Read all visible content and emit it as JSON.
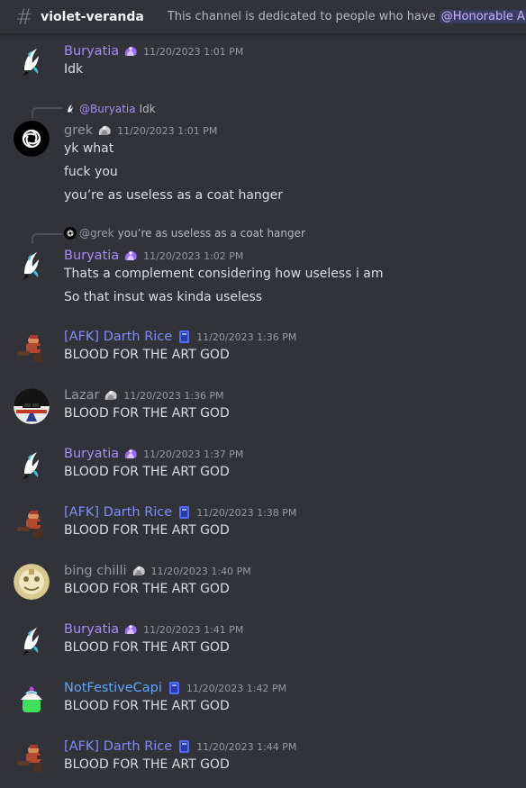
{
  "header": {
    "channel": "violet-veranda",
    "topic_text": "This channel is dedicated to people who have",
    "topic_mention": "@Honorable Artist"
  },
  "colors": {
    "background": "#313338",
    "buryatia": "#a78bfa",
    "afk": "#818cf8",
    "grey_user": "#949ba4",
    "notfestive": "#60a5fa"
  },
  "messages": [
    {
      "author": "Buryatia",
      "avatar": "buryatia-avatar",
      "badge": "purple-badge-icon",
      "time": "11/20/2023 1:01 PM",
      "lines": [
        "Idk"
      ]
    },
    {
      "reply_to": "@Buryatia",
      "reply_text": "Idk",
      "author": "grek",
      "avatar": "grek-avatar",
      "badge": "grey-badge-icon",
      "time": "11/20/2023 1:01 PM",
      "lines": [
        "yk what",
        "fuck you",
        "you’re as useless as a coat hanger"
      ]
    },
    {
      "reply_to": "@grek",
      "reply_text": "you’re as useless as a coat hanger",
      "author": "Buryatia",
      "avatar": "buryatia-avatar",
      "badge": "purple-badge-icon",
      "time": "11/20/2023 1:02 PM",
      "lines": [
        "Thats a complement considering how useless i am",
        "So that insut was kinda useless"
      ]
    },
    {
      "author": "[AFK] Darth Rice",
      "avatar": "darth-rice-avatar",
      "badge": "blue-badge-icon",
      "time": "11/20/2023 1:36 PM",
      "lines": [
        "BLOOD FOR THE ART GOD"
      ]
    },
    {
      "author": "Lazar",
      "avatar": "lazar-avatar",
      "badge": "grey-badge-icon",
      "time": "11/20/2023 1:36 PM",
      "lines": [
        "BLOOD FOR THE ART GOD"
      ]
    },
    {
      "author": "Buryatia",
      "avatar": "buryatia-avatar",
      "badge": "purple-badge-icon",
      "time": "11/20/2023 1:37 PM",
      "lines": [
        "BLOOD FOR THE ART GOD"
      ]
    },
    {
      "author": "[AFK] Darth Rice",
      "avatar": "darth-rice-avatar",
      "badge": "blue-badge-icon",
      "time": "11/20/2023 1:38 PM",
      "lines": [
        "BLOOD FOR THE ART GOD"
      ]
    },
    {
      "author": "bing chilli",
      "avatar": "bing-chilli-avatar",
      "badge": "grey-badge-icon",
      "time": "11/20/2023 1:40 PM",
      "lines": [
        "BLOOD FOR THE ART GOD"
      ]
    },
    {
      "author": "Buryatia",
      "avatar": "buryatia-avatar",
      "badge": "purple-badge-icon",
      "time": "11/20/2023 1:41 PM",
      "lines": [
        "BLOOD FOR THE ART GOD"
      ]
    },
    {
      "author": "NotFestiveCapi",
      "avatar": "notfestivecapi-avatar",
      "badge": "blue-badge-icon",
      "time": "11/20/2023 1:42 PM",
      "lines": [
        "BLOOD FOR THE ART GOD"
      ]
    },
    {
      "author": "[AFK] Darth Rice",
      "avatar": "darth-rice-avatar",
      "badge": "blue-badge-icon",
      "time": "11/20/2023 1:44 PM",
      "lines": [
        "BLOOD FOR THE ART GOD"
      ]
    }
  ]
}
